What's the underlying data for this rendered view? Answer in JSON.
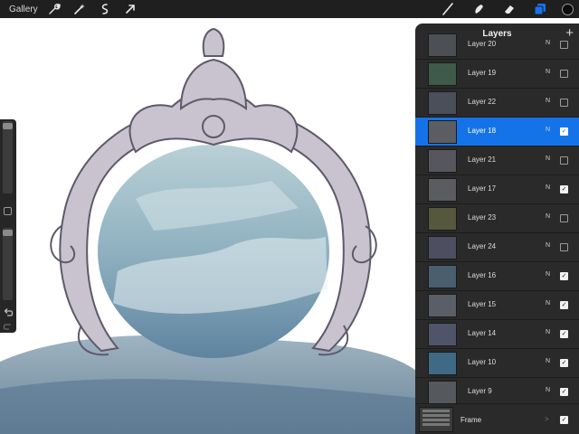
{
  "topbar": {
    "gallery_label": "Gallery",
    "left_tools": [
      "wrench-icon",
      "magic-wand-icon",
      "selection-icon",
      "transform-icon"
    ],
    "right_tools": [
      "brush-icon",
      "smudge-icon",
      "eraser-icon",
      "layers-icon"
    ],
    "active_tool": "layers-icon",
    "accent_color": "#1573ea",
    "current_color": "#0b0b0b"
  },
  "sidebar": {
    "undo_icon": "undo-icon",
    "redo_icon": "redo-icon"
  },
  "layers_panel": {
    "title": "Layers",
    "add_label": "+",
    "layers": [
      {
        "name": "Layer 20",
        "mode": "N",
        "visible": false,
        "selected": false
      },
      {
        "name": "Layer 19",
        "mode": "N",
        "visible": false,
        "selected": false
      },
      {
        "name": "Layer 22",
        "mode": "N",
        "visible": false,
        "selected": false
      },
      {
        "name": "Layer 18",
        "mode": "N",
        "visible": true,
        "selected": true
      },
      {
        "name": "Layer 21",
        "mode": "N",
        "visible": false,
        "selected": false
      },
      {
        "name": "Layer 17",
        "mode": "N",
        "visible": true,
        "selected": false
      },
      {
        "name": "Layer 23",
        "mode": "N",
        "visible": false,
        "selected": false
      },
      {
        "name": "Layer 24",
        "mode": "N",
        "visible": false,
        "selected": false
      },
      {
        "name": "Layer 16",
        "mode": "N",
        "visible": true,
        "selected": false
      },
      {
        "name": "Layer 15",
        "mode": "N",
        "visible": true,
        "selected": false
      },
      {
        "name": "Layer 14",
        "mode": "N",
        "visible": true,
        "selected": false
      },
      {
        "name": "Layer 10",
        "mode": "N",
        "visible": true,
        "selected": false
      },
      {
        "name": "Layer 9",
        "mode": "N",
        "visible": true,
        "selected": false
      }
    ],
    "frame": {
      "name": "Frame",
      "chevron": ">",
      "visible": true
    }
  }
}
